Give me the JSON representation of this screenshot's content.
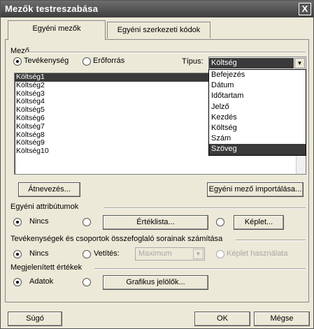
{
  "window": {
    "title": "Mezők testreszabása",
    "close_glyph": "X"
  },
  "tabs": [
    {
      "label": "Egyéni mezők",
      "active": true
    },
    {
      "label": "Egyéni szerkezeti kódok",
      "active": false
    }
  ],
  "field_group": {
    "label": "Mező",
    "radio_task": "Tevékenység",
    "radio_resource": "Erőforrás",
    "type_label": "Típus:",
    "type_value": "Költség",
    "type_options": [
      "Befejezés",
      "Dátum",
      "Időtartam",
      "Jelző",
      "Kezdés",
      "Költség",
      "Szám",
      "Szöveg"
    ],
    "type_highlighted": "Szöveg",
    "fields": [
      "Költség1",
      "Költség2",
      "Költség3",
      "Költség4",
      "Költség5",
      "Költség6",
      "Költség7",
      "Költség8",
      "Költség9",
      "Költség10"
    ]
  },
  "buttons": {
    "rename": "Átnevezés...",
    "import": "Egyéni mező importálása...",
    "value_list": "Értéklista...",
    "formula": "Képlet...",
    "graphical": "Grafikus jelölők...",
    "help": "Súgó",
    "ok": "OK",
    "cancel": "Mégse"
  },
  "attributes": {
    "label": "Egyéni attribútumok",
    "none": "Nincs"
  },
  "summary": {
    "label": "Tevékenységek és csoportok összefoglaló sorainak számítása",
    "none": "Nincs",
    "rollup": "Vetítés:",
    "rollup_value": "Maximum",
    "use_formula": "Képlet használata"
  },
  "display": {
    "label": "Megjelenített értékek",
    "data": "Adatok"
  }
}
